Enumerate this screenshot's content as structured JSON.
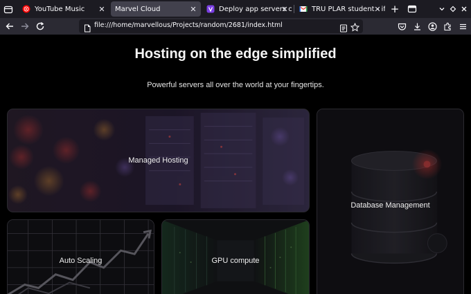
{
  "browser": {
    "tabs": [
      {
        "title": "YouTube Music",
        "favicon": "youtube-music-icon",
        "active": false
      },
      {
        "title": "Marvel Cloud",
        "favicon": "none",
        "active": true
      },
      {
        "title": "Deploy app servers close t",
        "favicon": "fly-io-icon",
        "active": false
      },
      {
        "title": "TRU PLAR student - ifezuej",
        "favicon": "gmail-icon",
        "active": false
      }
    ],
    "url": "file:///home/marvellous/Projects/random/2681/index.html"
  },
  "page": {
    "title": "Hosting on the edge simplified",
    "subtitle": "Powerful servers all over the world at your fingertips.",
    "cards": {
      "managed": "Managed Hosting",
      "database": "Database Management",
      "autoscaling": "Auto Scaling",
      "gpu": "GPU compute"
    }
  },
  "colors": {
    "tabstrip": "#1c1b22",
    "active_tab": "#42414d",
    "navbar": "#2b2a33",
    "urlbar": "#1c1b22",
    "page_bg": "#000000"
  }
}
